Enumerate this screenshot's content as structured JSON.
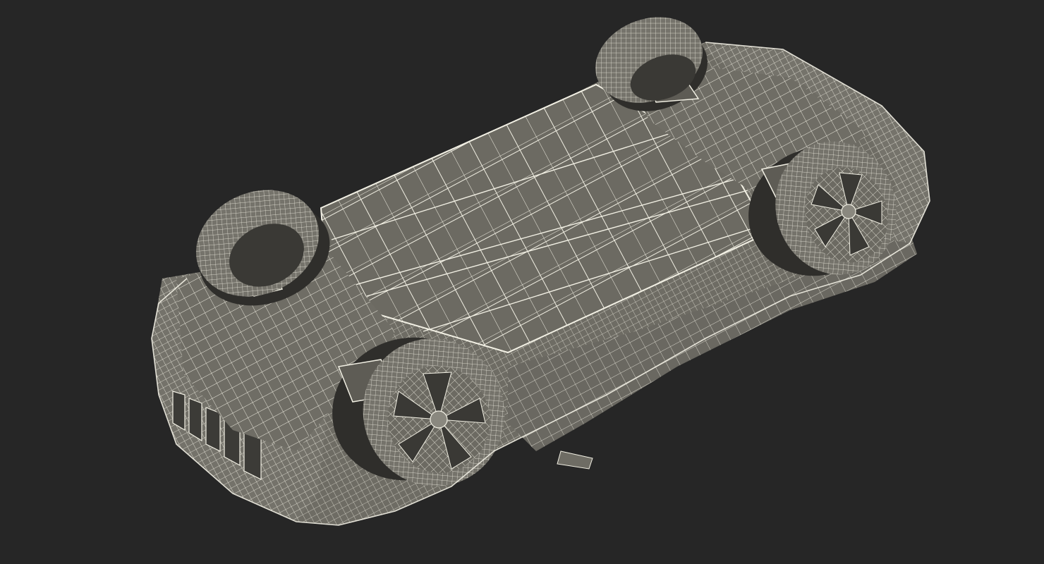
{
  "scene": {
    "subject": "wireframe-car-underside",
    "background_color": "#262626",
    "wire_color": "#f2f0e4",
    "surface_color": "#6e6c64",
    "surface_dark": "#55534c",
    "shadow_color": "#2e2d2a",
    "tire_color": "#75736b",
    "icons": {
      "car": "wireframe-car-icon",
      "wheel": "wheel-icon"
    }
  }
}
